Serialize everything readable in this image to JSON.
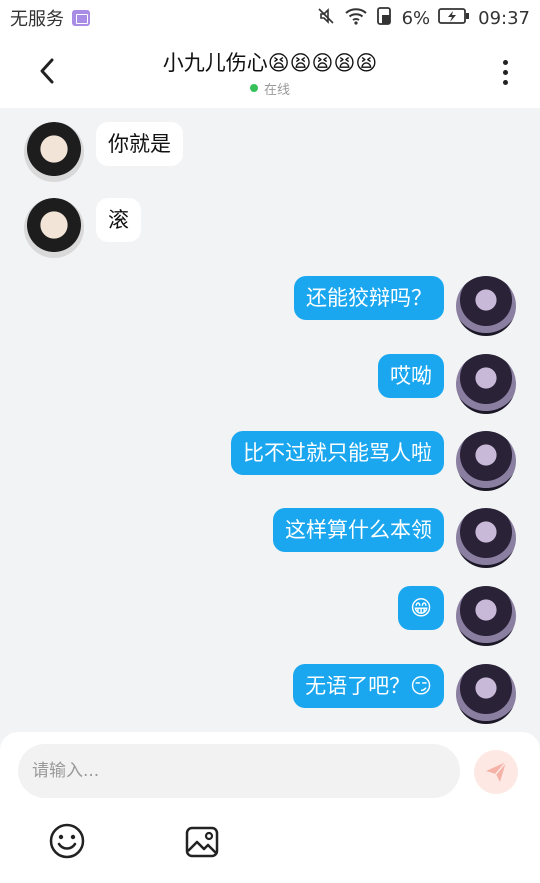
{
  "status_bar": {
    "carrier": "无服务",
    "battery_percent": "6%",
    "time": "09:37",
    "icons": [
      "sim-icon",
      "mute-icon",
      "wifi-icon",
      "data-icon",
      "battery-charging-icon"
    ]
  },
  "header": {
    "title": "小九儿伤心😫😫😫😫😫",
    "status": "在线",
    "back_icon": "chevron-left-icon",
    "more_icon": "more-vertical-icon"
  },
  "messages": [
    {
      "direction": "in",
      "text": "你就是"
    },
    {
      "direction": "in",
      "text": "滚"
    },
    {
      "direction": "out",
      "text": "还能狡辩吗？"
    },
    {
      "direction": "out",
      "text": "哎呦"
    },
    {
      "direction": "out",
      "text": "比不过就只能骂人啦"
    },
    {
      "direction": "out",
      "text": "这样算什么本领"
    },
    {
      "direction": "out",
      "text": "😁"
    },
    {
      "direction": "out",
      "text": "无语了吧？😏"
    }
  ],
  "composer": {
    "placeholder": "请输入...",
    "value": "",
    "send_icon": "send-icon",
    "tools": [
      "emoji-icon",
      "image-icon"
    ]
  },
  "colors": {
    "outgoing_bubble": "#1aa7ef",
    "incoming_bubble": "#ffffff",
    "background": "#f2f3f5",
    "online": "#36c05a",
    "send_button": "#fde8e4"
  }
}
